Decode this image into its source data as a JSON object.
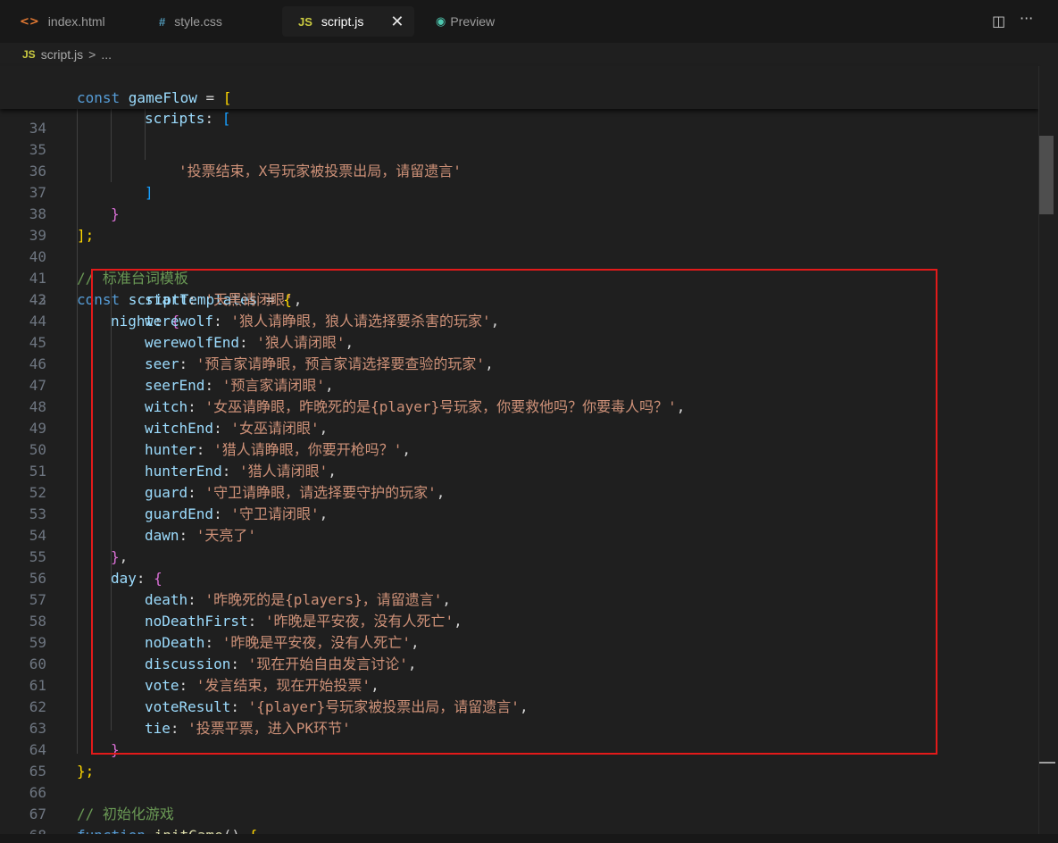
{
  "tabs": [
    {
      "icon": "<>",
      "label": "index.html"
    },
    {
      "icon": "#",
      "label": "style.css"
    },
    {
      "icon": "JS",
      "label": "script.js"
    },
    {
      "icon": "eye",
      "label": "Preview"
    }
  ],
  "close_glyph": "✕",
  "toolbar": {
    "split_glyph": "◫",
    "more_glyph": "···"
  },
  "breadcrumb": {
    "icon": "JS",
    "file": "script.js",
    "sep": ">",
    "rest": "..."
  },
  "sticky": [
    [
      "const ",
      "gameFlow",
      " = ",
      "["
    ],
    [
      "scripts",
      ": ",
      "["
    ]
  ],
  "code": {
    "35": "'投票结束，X号玩家被投票出局，请留遗言'",
    "36": "]",
    "37": "}",
    "38": "];",
    "40": "// 标准台词模板",
    "41": [
      "const ",
      "scriptTemplates",
      " = ",
      "{"
    ],
    "42": [
      "night",
      ": ",
      "{"
    ],
    "43": [
      "start",
      ": ",
      "'天黑请闭眼'",
      ","
    ],
    "44": [
      "werewolf",
      ": ",
      "'狼人请睁眼，狼人请选择要杀害的玩家'",
      ","
    ],
    "45": [
      "werewolfEnd",
      ": ",
      "'狼人请闭眼'",
      ","
    ],
    "46": [
      "seer",
      ": ",
      "'预言家请睁眼，预言家请选择要查验的玩家'",
      ","
    ],
    "47": [
      "seerEnd",
      ": ",
      "'预言家请闭眼'",
      ","
    ],
    "48": [
      "witch",
      ": ",
      "'女巫请睁眼，昨晚死的是{player}号玩家，你要救他吗？你要毒人吗？'",
      ","
    ],
    "49": [
      "witchEnd",
      ": ",
      "'女巫请闭眼'",
      ","
    ],
    "50": [
      "hunter",
      ": ",
      "'猎人请睁眼，你要开枪吗？'",
      ","
    ],
    "51": [
      "hunterEnd",
      ": ",
      "'猎人请闭眼'",
      ","
    ],
    "52": [
      "guard",
      ": ",
      "'守卫请睁眼，请选择要守护的玩家'",
      ","
    ],
    "53": [
      "guardEnd",
      ": ",
      "'守卫请闭眼'",
      ","
    ],
    "54": [
      "dawn",
      ": ",
      "'天亮了'",
      ""
    ],
    "55": [
      "}",
      ","
    ],
    "56": [
      "day",
      ": ",
      "{"
    ],
    "57": [
      "death",
      ": ",
      "'昨晚死的是{players}，请留遗言'",
      ","
    ],
    "58": [
      "noDeathFirst",
      ": ",
      "'昨晚是平安夜，没有人死亡'",
      ","
    ],
    "59": [
      "noDeath",
      ": ",
      "'昨晚是平安夜，没有人死亡'",
      ","
    ],
    "60": [
      "discussion",
      ": ",
      "'现在开始自由发言讨论'",
      ","
    ],
    "61": [
      "vote",
      ": ",
      "'发言结束，现在开始投票'",
      ","
    ],
    "62": [
      "voteResult",
      ": ",
      "'{player}号玩家被投票出局，请留遗言'",
      ","
    ],
    "63": [
      "tie",
      ": ",
      "'投票平票，进入PK环节'",
      ""
    ],
    "64": "}",
    "65": "};",
    "67": "// 初始化游戏",
    "68": [
      "function ",
      "initGame",
      "() ",
      "{"
    ]
  },
  "line_numbers": [
    "35",
    "36",
    "37",
    "38",
    "39",
    "40",
    "41",
    "42",
    "43",
    "44",
    "45",
    "46",
    "47",
    "48",
    "49",
    "50",
    "51",
    "52",
    "53",
    "54",
    "55",
    "56",
    "57",
    "58",
    "59",
    "60",
    "61",
    "62",
    "63",
    "64",
    "65",
    "66",
    "67",
    "68"
  ],
  "partial_line_number": "34",
  "colors": {
    "keyword": "#569cd6",
    "function": "#dcdcaa",
    "variable": "#9cdcfe",
    "string": "#ce9178",
    "comment": "#6a9955",
    "bracket_1": "#ffd700",
    "bracket_2": "#da70d6",
    "bracket_3": "#179fff",
    "highlight_box": "#e21a1a"
  }
}
